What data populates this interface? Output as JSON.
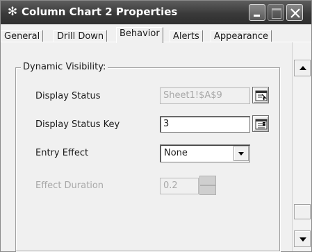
{
  "window": {
    "title": "Column Chart 2 Properties",
    "icon": "gear-icon",
    "controls": [
      "minimize-icon",
      "maximize-icon",
      "close-icon"
    ]
  },
  "tabs": [
    {
      "label": "General",
      "active": false
    },
    {
      "label": "Drill Down",
      "active": false
    },
    {
      "label": "Behavior",
      "active": true
    },
    {
      "label": "Alerts",
      "active": false
    },
    {
      "label": "Appearance",
      "active": false
    }
  ],
  "group": {
    "label": "Dynamic Visibility:"
  },
  "fields": {
    "display_status": {
      "label": "Display Status",
      "value": "Sheet1!$A$9",
      "enabled": false
    },
    "display_status_key": {
      "label": "Display Status Key",
      "value": "3",
      "enabled": true
    },
    "entry_effect": {
      "label": "Entry Effect",
      "value": "None",
      "enabled": true
    },
    "effect_duration": {
      "label": "Effect Duration",
      "value": "0.2",
      "enabled": false
    }
  },
  "colors": {
    "titlebar": "#3a3a3a",
    "panel": "#f0f0f0",
    "disabled_text": "#a8a8a8"
  }
}
